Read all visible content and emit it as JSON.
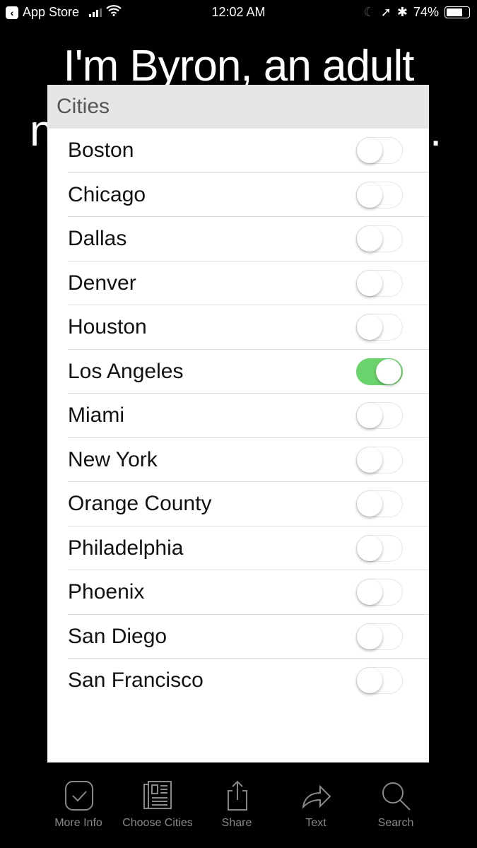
{
  "status": {
    "back_label": "App Store",
    "time": "12:02 AM",
    "battery": "74%",
    "battery_level": 0.74
  },
  "background": {
    "line1": "I'm Byron, an adult",
    "line2_start": "n",
    "line2_end": "."
  },
  "modal": {
    "title": "Cities",
    "cities": [
      {
        "name": "Boston",
        "on": false
      },
      {
        "name": "Chicago",
        "on": false
      },
      {
        "name": "Dallas",
        "on": false
      },
      {
        "name": "Denver",
        "on": false
      },
      {
        "name": "Houston",
        "on": false
      },
      {
        "name": "Los Angeles",
        "on": true
      },
      {
        "name": "Miami",
        "on": false
      },
      {
        "name": "New York",
        "on": false
      },
      {
        "name": "Orange County",
        "on": false
      },
      {
        "name": "Philadelphia",
        "on": false
      },
      {
        "name": "Phoenix",
        "on": false
      },
      {
        "name": "San Diego",
        "on": false
      },
      {
        "name": "San Francisco",
        "on": false
      }
    ]
  },
  "tabbar": [
    {
      "label": "More Info",
      "icon": "checkmark-box-icon"
    },
    {
      "label": "Choose Cities",
      "icon": "newspaper-icon"
    },
    {
      "label": "Share",
      "icon": "share-icon"
    },
    {
      "label": "Text",
      "icon": "forward-arrow-icon"
    },
    {
      "label": "Search",
      "icon": "search-icon"
    }
  ],
  "colors": {
    "toggle_on": "#6bd36b",
    "header_bg": "#e6e6e6"
  }
}
